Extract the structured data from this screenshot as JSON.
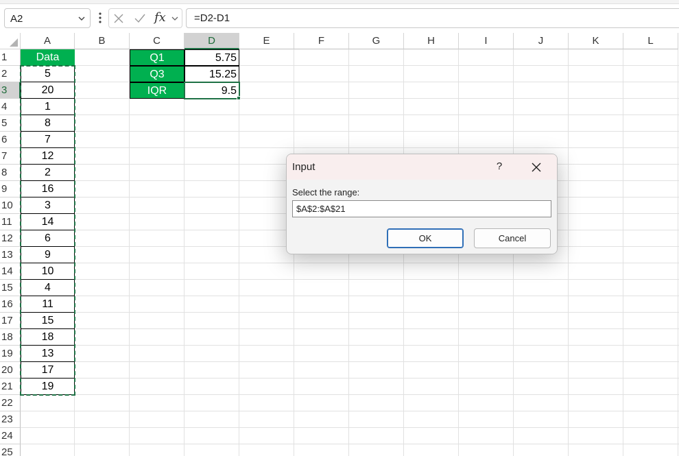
{
  "formula_bar": {
    "name_box": "A2",
    "fx_label": "fx",
    "formula": "=D2-D1"
  },
  "columns": [
    "A",
    "B",
    "C",
    "D",
    "E",
    "F",
    "G",
    "H",
    "I",
    "J",
    "K",
    "L"
  ],
  "rows": [
    "1",
    "2",
    "3",
    "4",
    "5",
    "6",
    "7",
    "8",
    "9",
    "10",
    "11",
    "12",
    "13",
    "14",
    "15",
    "16",
    "17",
    "18",
    "19",
    "20",
    "21",
    "22",
    "23",
    "24",
    "25"
  ],
  "sheet": {
    "data_header": "Data",
    "data_values": [
      "5",
      "20",
      "1",
      "8",
      "7",
      "12",
      "2",
      "16",
      "3",
      "14",
      "6",
      "9",
      "10",
      "4",
      "11",
      "15",
      "18",
      "13",
      "17",
      "19"
    ],
    "stats": [
      {
        "label": "Q1",
        "value": "5.75"
      },
      {
        "label": "Q3",
        "value": "15.25"
      },
      {
        "label": "IQR",
        "value": "9.5"
      }
    ]
  },
  "dialog": {
    "title": "Input",
    "help": "?",
    "prompt": "Select the range:",
    "input_value": "$A$2:$A$21",
    "ok_label": "OK",
    "cancel_label": "Cancel"
  },
  "colors": {
    "header_green": "#00b050",
    "selection_green": "#1e7145"
  }
}
